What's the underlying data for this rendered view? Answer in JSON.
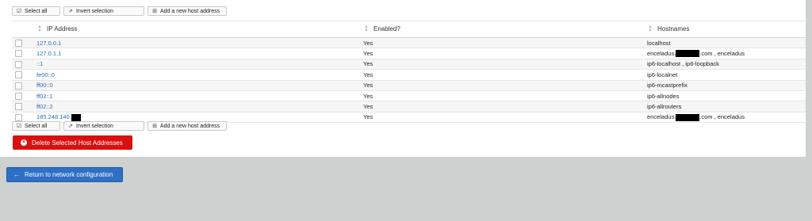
{
  "toolbar": {
    "select_all": "Select all",
    "invert_selection": "Invert selection",
    "add_host": "Add a new host address"
  },
  "table": {
    "columns": [
      "IP Address",
      "Enabled?",
      "Hostnames"
    ],
    "rows": [
      {
        "ip": "127.0.0.1",
        "enabled": "Yes",
        "host_pre": "localhost",
        "host_post": ""
      },
      {
        "ip": "127.0.1.1",
        "enabled": "Yes",
        "host_pre": "enceladus.",
        "host_post": ".com , enceladus"
      },
      {
        "ip": "::1",
        "enabled": "Yes",
        "host_pre": "ip6-localhost , ip6-loopback",
        "host_post": ""
      },
      {
        "ip": "fe00::0",
        "enabled": "Yes",
        "host_pre": "ip6-localnet",
        "host_post": ""
      },
      {
        "ip": "ff00::0",
        "enabled": "Yes",
        "host_pre": "ip6-mcastprefix",
        "host_post": ""
      },
      {
        "ip": "ff02::1",
        "enabled": "Yes",
        "host_pre": "ip6-allnodes",
        "host_post": ""
      },
      {
        "ip": "ff02::2",
        "enabled": "Yes",
        "host_pre": "ip6-allrouters",
        "host_post": ""
      },
      {
        "ip": "185.248.140.",
        "enabled": "Yes",
        "host_pre": "enceladus.",
        "host_post": ".com , enceladus"
      }
    ]
  },
  "actions": {
    "delete_selected": "Delete Selected Host Addresses",
    "return": "Return to network configuration"
  },
  "colors": {
    "delete_button": "#d9100f",
    "return_button": "#2f6fc4",
    "link": "#2a6ab8",
    "page_background": "#cfd1d0"
  },
  "icons": {
    "select_all": "check-square-icon",
    "invert_selection": "external-link-icon",
    "add_host": "plus-square-icon",
    "delete": "times-circle-icon",
    "return": "arrow-left-icon"
  }
}
